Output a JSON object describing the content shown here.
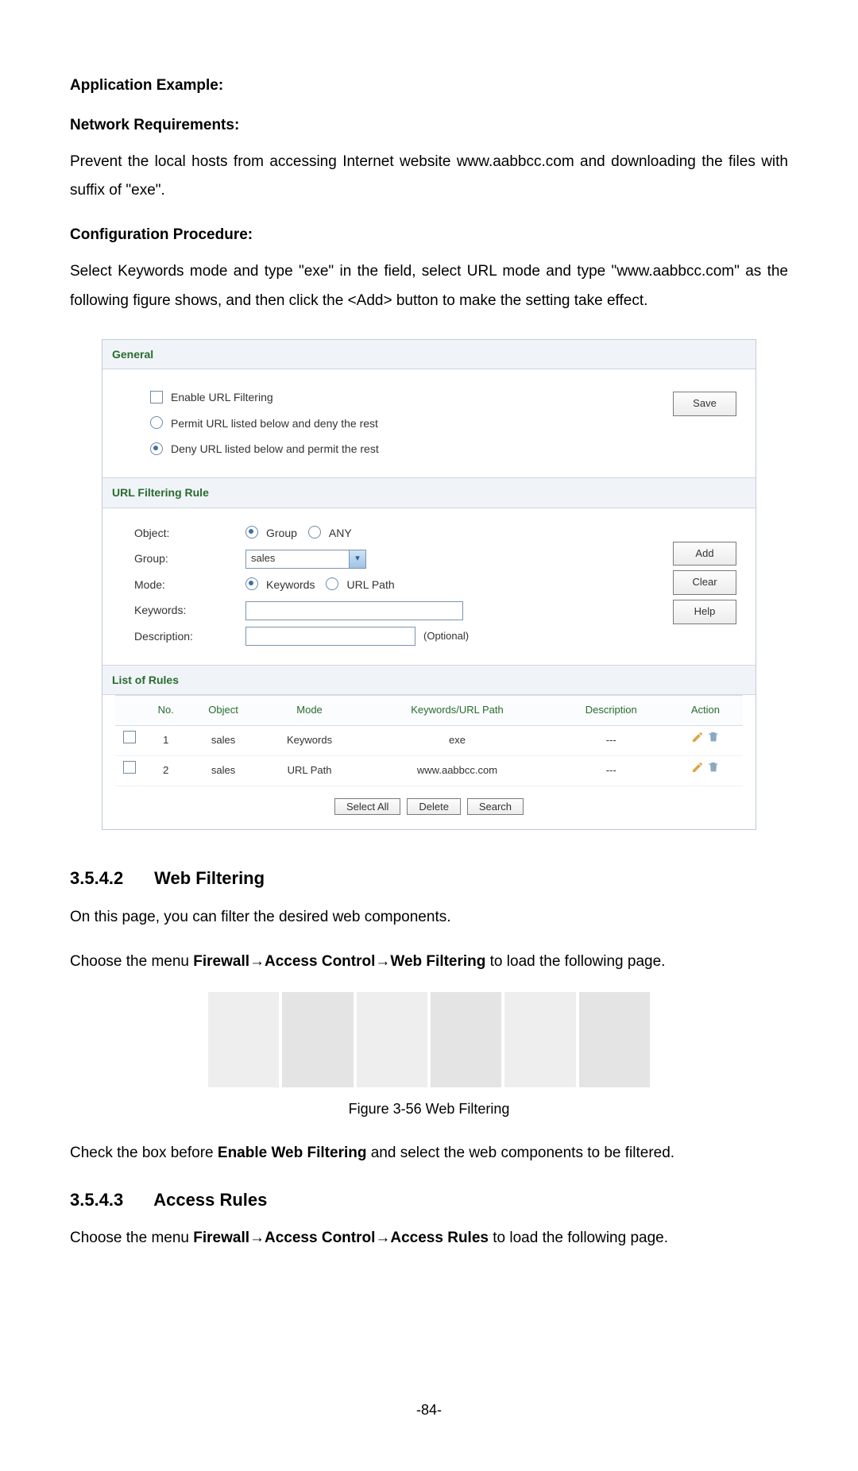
{
  "text": {
    "app_example": "Application Example:",
    "net_req": "Network Requirements:",
    "para1": "Prevent the local hosts from accessing Internet website www.aabbcc.com and downloading the files with suffix of \"exe\".",
    "conf_proc": "Configuration Procedure:",
    "para2": "Select Keywords mode and type \"exe\" in the field, select URL mode and type \"www.aabbcc.com\" as the following figure shows, and then click the <Add> button to make the setting take effect.",
    "sec_3542_num": "3.5.4.2",
    "sec_3542_title": "Web Filtering",
    "para3": "On this page, you can filter the desired web components.",
    "para4a": "Choose the menu ",
    "para4b": " to load the following page.",
    "menu1": "Firewall→Access Control→Web Filtering",
    "fig_caption": "Figure 3-56 Web Filtering",
    "para5a": "Check the box before ",
    "para5b": " and select the web components to be filtered.",
    "enable_wf": "Enable Web Filtering",
    "sec_3543_num": "3.5.4.3",
    "sec_3543_title": "Access Rules",
    "para6a": "Choose the menu ",
    "para6b": " to load the following page.",
    "menu2": "Firewall→Access Control→Access Rules",
    "page_num": "-84-"
  },
  "figure": {
    "general": {
      "title": "General",
      "enable_label": "Enable URL Filtering",
      "permit_label": "Permit URL listed below and deny the rest",
      "deny_label": "Deny URL listed below and permit the rest",
      "save_btn": "Save"
    },
    "rule": {
      "title": "URL Filtering Rule",
      "object_label": "Object:",
      "object_opt_group": "Group",
      "object_opt_any": "ANY",
      "group_label": "Group:",
      "group_value": "sales",
      "mode_label": "Mode:",
      "mode_opt_kw": "Keywords",
      "mode_opt_url": "URL Path",
      "kw_label": "Keywords:",
      "desc_label": "Description:",
      "desc_hint": "(Optional)",
      "btn_add": "Add",
      "btn_clear": "Clear",
      "btn_help": "Help"
    },
    "list": {
      "title": "List of Rules",
      "cols": {
        "no": "No.",
        "object": "Object",
        "mode": "Mode",
        "kw": "Keywords/URL Path",
        "desc": "Description",
        "action": "Action"
      },
      "rows": [
        {
          "no": "1",
          "object": "sales",
          "mode": "Keywords",
          "kw": "exe",
          "desc": "---"
        },
        {
          "no": "2",
          "object": "sales",
          "mode": "URL Path",
          "kw": "www.aabbcc.com",
          "desc": "---"
        }
      ],
      "btn_select_all": "Select All",
      "btn_delete": "Delete",
      "btn_search": "Search"
    }
  }
}
